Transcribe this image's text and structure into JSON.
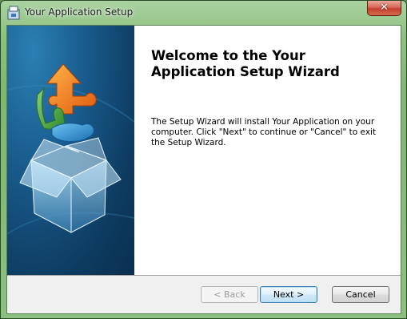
{
  "window": {
    "title": "Your Application Setup",
    "close_label": "✕"
  },
  "wizard": {
    "title": "Welcome to the Your Application Setup Wizard",
    "description": "The Setup Wizard will install Your Application on your computer.  Click \"Next\" to continue or \"Cancel\" to exit the Setup Wizard."
  },
  "buttons": {
    "back": "< Back",
    "next": "Next >",
    "cancel": "Cancel"
  },
  "icons": {
    "app": "installer-icon",
    "banner": "puzzle-box-icon",
    "close": "close-icon"
  },
  "colors": {
    "banner": "#1a5d8f",
    "default_button_border": "#3c7fb1",
    "close_button": "#c4402d"
  }
}
